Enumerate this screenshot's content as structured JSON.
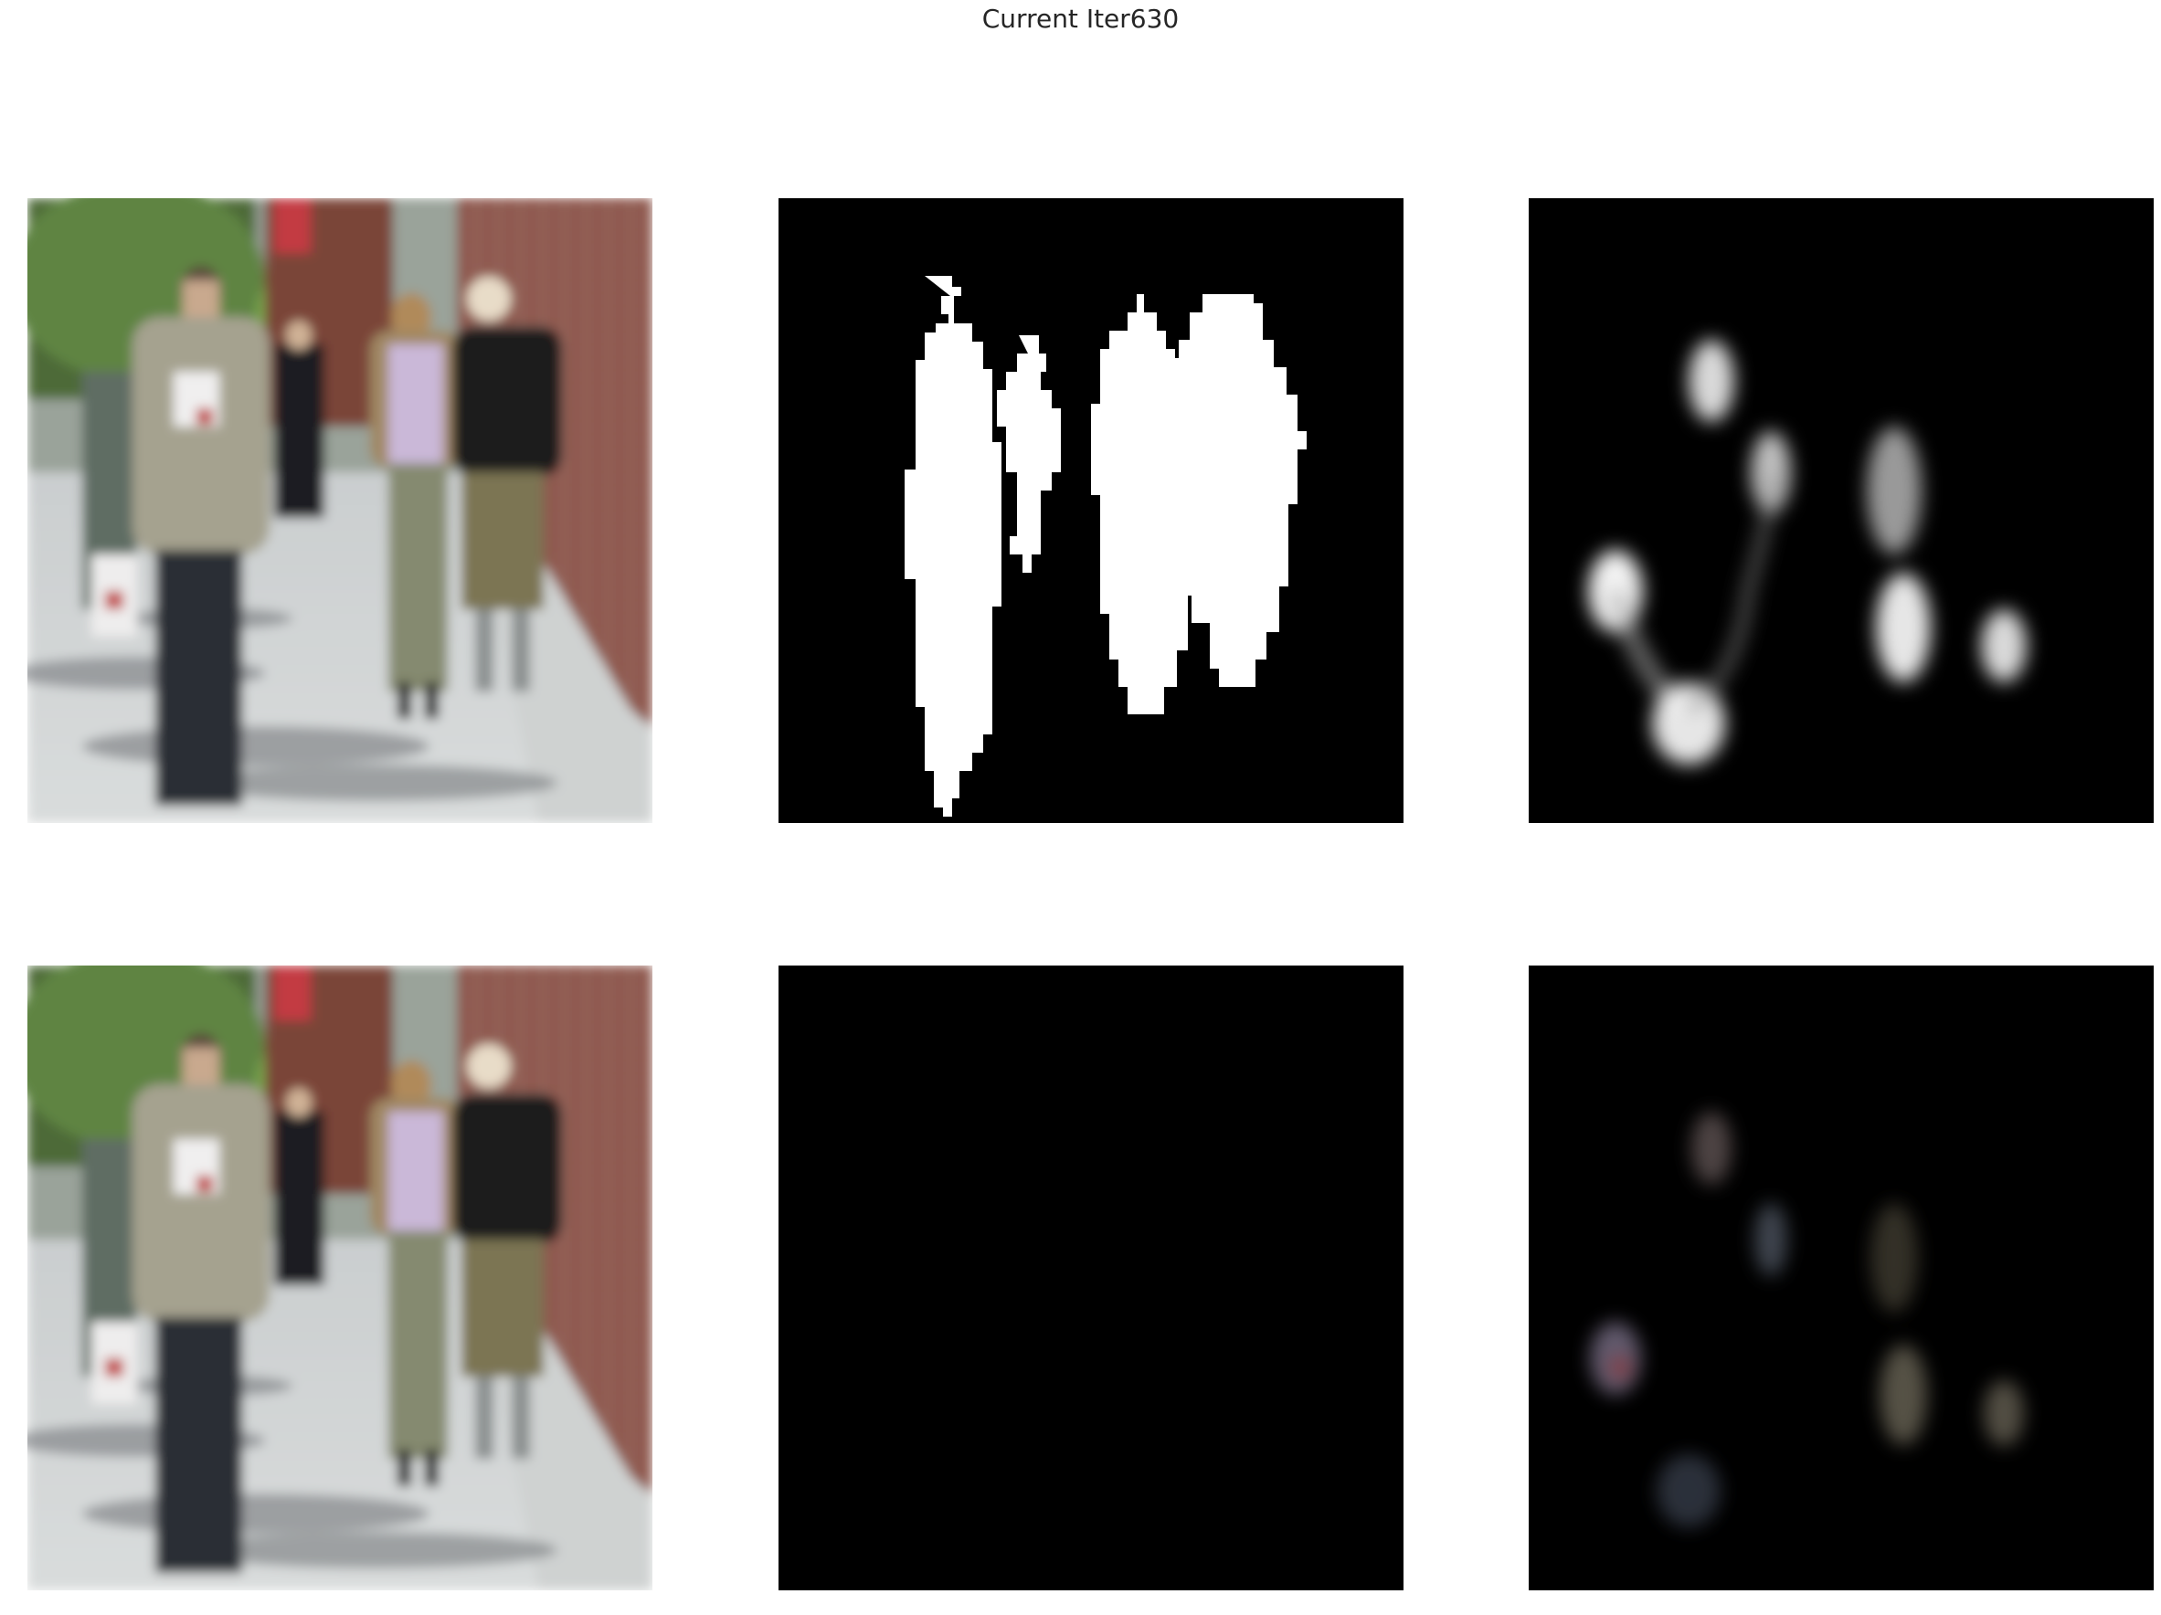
{
  "figure": {
    "suptitle": "Current Iter630"
  },
  "colors": {
    "background": "#ffffff",
    "mask_bg": "#000000",
    "mask_fg": "#ffffff"
  }
}
